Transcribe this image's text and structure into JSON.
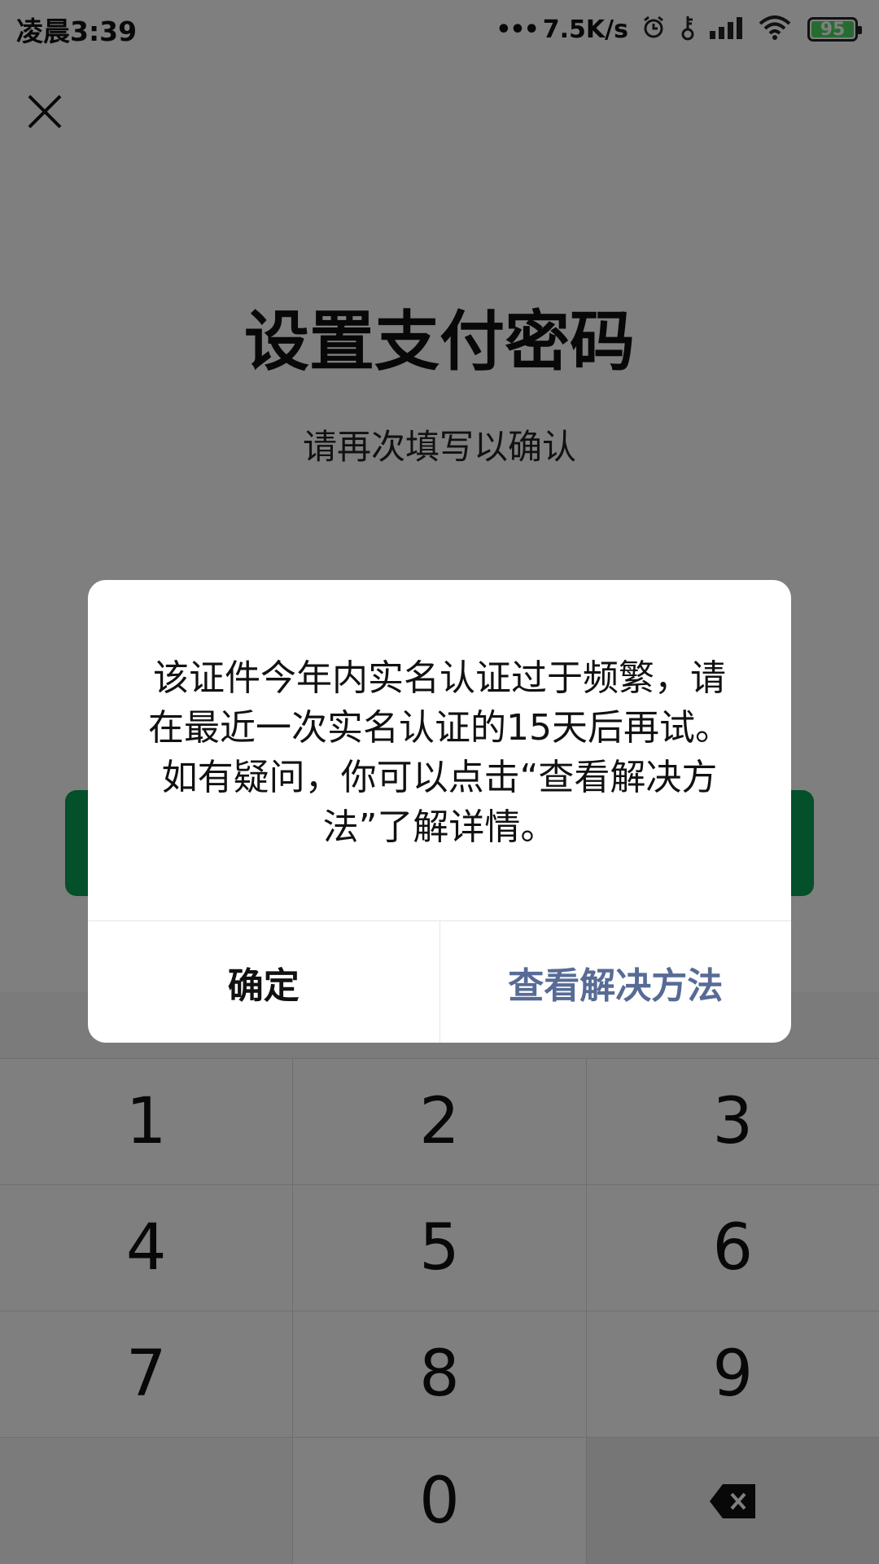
{
  "status_bar": {
    "time": "凌晨3:39",
    "network_speed": "7.5K/s",
    "battery_level": "95",
    "icons": [
      "more-dots-icon",
      "alarm-icon",
      "key-icon",
      "signal-icon",
      "wifi-icon",
      "battery-icon"
    ]
  },
  "page": {
    "title": "设置支付密码",
    "subtitle": "请再次填写以确认",
    "close_icon": "close-icon",
    "primary_color": "#07a154"
  },
  "keypad": {
    "rows": [
      [
        "1",
        "2",
        "3"
      ],
      [
        "4",
        "5",
        "6"
      ],
      [
        "7",
        "8",
        "9"
      ],
      [
        "",
        "0",
        "backspace-icon"
      ]
    ]
  },
  "dialog": {
    "message": "该证件今年内实名认证过于频繁，请在最近一次实名认证的15天后再试。如有疑问，你可以点击“查看解决方法”了解详情。",
    "confirm_label": "确定",
    "solution_label": "查看解决方法",
    "solution_color": "#576b95"
  }
}
